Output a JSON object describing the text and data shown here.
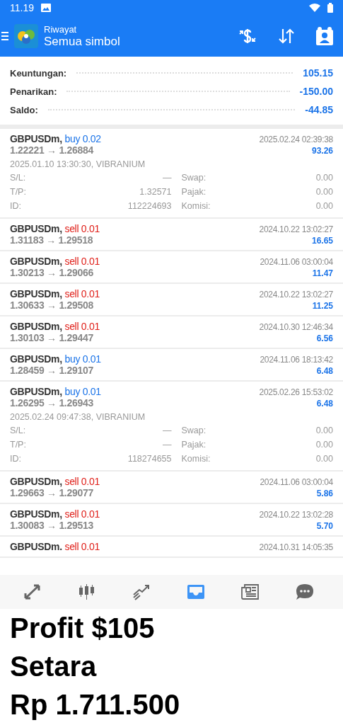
{
  "status_bar": {
    "time": "11.19"
  },
  "app_bar": {
    "subtitle": "Riwayat",
    "title": "Semua simbol"
  },
  "summary": [
    {
      "label": "Keuntungan:",
      "value": "105.15"
    },
    {
      "label": "Penarikan:",
      "value": "-150.00"
    },
    {
      "label": "Saldo:",
      "value": "-44.85"
    }
  ],
  "trades": [
    {
      "symbol": "GBPUSDm,",
      "side": "buy",
      "volume": "0.02",
      "prices": "1.22221 → 1.26884",
      "time": "2025.02.24 02:39:38",
      "profit": "93.26",
      "details": {
        "opened": "2025.01.10 13:30:30, VIBRANIUM",
        "fields": [
          {
            "label": "S/L:",
            "value": "—"
          },
          {
            "label": "Swap:",
            "value": "0.00"
          },
          {
            "label": "T/P:",
            "value": "1.32571"
          },
          {
            "label": "Pajak:",
            "value": "0.00"
          },
          {
            "label": "ID:",
            "value": "112224693"
          },
          {
            "label": "Komisi:",
            "value": "0.00"
          }
        ]
      }
    },
    {
      "symbol": "GBPUSDm,",
      "side": "sell",
      "volume": "0.01",
      "prices": "1.31183 → 1.29518",
      "time": "2024.10.22 13:02:27",
      "profit": "16.65"
    },
    {
      "symbol": "GBPUSDm,",
      "side": "sell",
      "volume": "0.01",
      "prices": "1.30213 → 1.29066",
      "time": "2024.11.06 03:00:04",
      "profit": "11.47"
    },
    {
      "symbol": "GBPUSDm,",
      "side": "sell",
      "volume": "0.01",
      "prices": "1.30633 → 1.29508",
      "time": "2024.10.22 13:02:27",
      "profit": "11.25"
    },
    {
      "symbol": "GBPUSDm,",
      "side": "sell",
      "volume": "0.01",
      "prices": "1.30103 → 1.29447",
      "time": "2024.10.30 12:46:34",
      "profit": "6.56"
    },
    {
      "symbol": "GBPUSDm,",
      "side": "buy",
      "volume": "0.01",
      "prices": "1.28459 → 1.29107",
      "time": "2024.11.06 18:13:42",
      "profit": "6.48"
    },
    {
      "symbol": "GBPUSDm,",
      "side": "buy",
      "volume": "0.01",
      "prices": "1.26295 → 1.26943",
      "time": "2025.02.26 15:53:02",
      "profit": "6.48",
      "details": {
        "opened": "2025.02.24 09:47:38, VIBRANIUM",
        "fields": [
          {
            "label": "S/L:",
            "value": "—"
          },
          {
            "label": "Swap:",
            "value": "0.00"
          },
          {
            "label": "T/P:",
            "value": "—"
          },
          {
            "label": "Pajak:",
            "value": "0.00"
          },
          {
            "label": "ID:",
            "value": "118274655"
          },
          {
            "label": "Komisi:",
            "value": "0.00"
          }
        ]
      }
    },
    {
      "symbol": "GBPUSDm,",
      "side": "sell",
      "volume": "0.01",
      "prices": "1.29663 → 1.29077",
      "time": "2024.11.06 03:00:04",
      "profit": "5.86"
    },
    {
      "symbol": "GBPUSDm,",
      "side": "sell",
      "volume": "0.01",
      "prices": "1.30083 → 1.29513",
      "time": "2024.10.22 13:02:28",
      "profit": "5.70"
    },
    {
      "symbol": "GBPUSDm.",
      "side": "sell",
      "volume": "0.01",
      "time": "2024.10.31 14:05:35"
    }
  ],
  "bottom_nav": [
    {
      "kind": "quotes",
      "selected": false
    },
    {
      "kind": "chart",
      "selected": false
    },
    {
      "kind": "trade",
      "selected": false
    },
    {
      "kind": "history",
      "selected": true
    },
    {
      "kind": "news",
      "selected": false
    },
    {
      "kind": "chat",
      "selected": false
    }
  ],
  "caption": [
    "Profit $105",
    "Setara",
    "Rp 1.711.500"
  ]
}
